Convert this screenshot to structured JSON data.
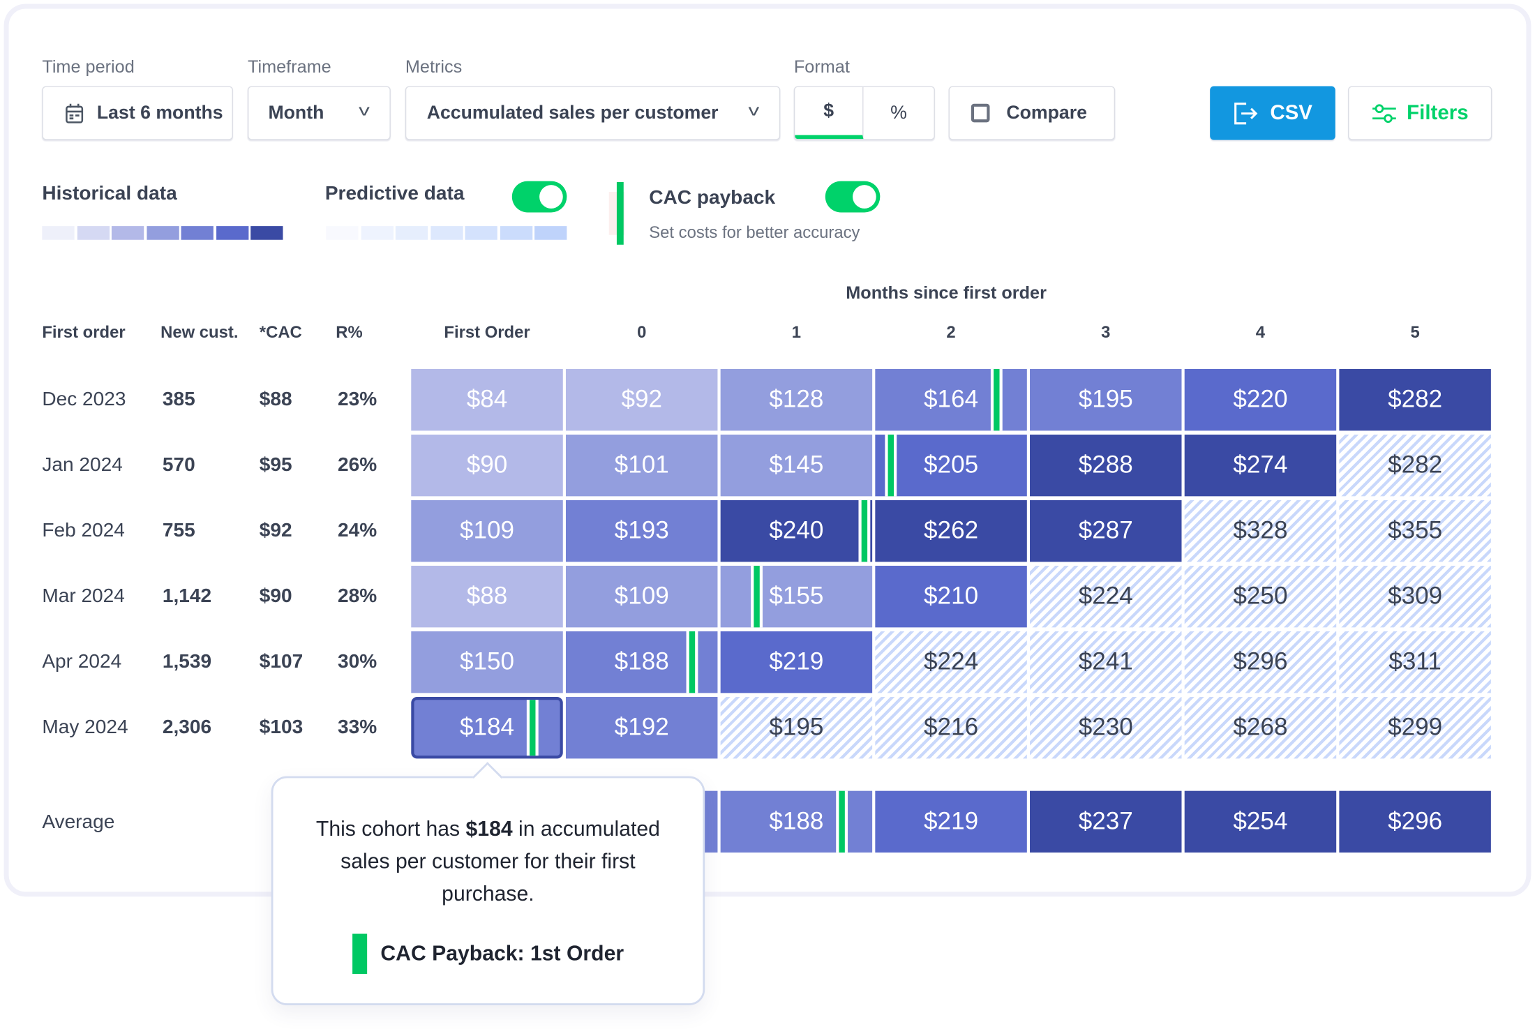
{
  "controls": {
    "time_period": {
      "label": "Time period",
      "value": "Last 6 months",
      "icon": "calendar-icon"
    },
    "timeframe": {
      "label": "Timeframe",
      "value": "Month"
    },
    "metrics": {
      "label": "Metrics",
      "value": "Accumulated sales per customer"
    },
    "format": {
      "label": "Format",
      "options": [
        "$",
        "%"
      ],
      "selected": "$"
    },
    "compare": {
      "label": "Compare",
      "checked": false
    },
    "csv": {
      "label": "CSV",
      "icon": "export-icon"
    },
    "filters": {
      "label": "Filters",
      "icon": "sliders-icon"
    }
  },
  "legend": {
    "historical": {
      "label": "Historical data",
      "swatches": [
        "#eef0fa",
        "#d5d9f3",
        "#b3b9e8",
        "#939ede",
        "#7280d4",
        "#5a6acc",
        "#3a4aa4"
      ]
    },
    "predictive": {
      "label": "Predictive data",
      "enabled": true,
      "swatches": [
        "#f8f9fe",
        "#eef3fe",
        "#e6eefd",
        "#dde8fd",
        "#d4e2fd",
        "#cbdcfc",
        "#bfd3fb"
      ]
    },
    "cac": {
      "label": "CAC payback",
      "sub": "Set costs for better accuracy",
      "enabled": true
    }
  },
  "colors": {
    "accent_green": "#00c863",
    "csv_blue": "#1297e0",
    "levels": [
      "#eef0fa",
      "#d5d9f3",
      "#b3b9e8",
      "#939ede",
      "#7280d4",
      "#5a6acc",
      "#3a4aa4"
    ]
  },
  "table": {
    "super_header": "Months since first order",
    "headers": [
      "First order",
      "New cust.",
      "*CAC",
      "R%"
    ],
    "month_headers": [
      "First Order",
      "0",
      "1",
      "2",
      "3",
      "4",
      "5"
    ],
    "rows": [
      {
        "first_order": "Dec 2023",
        "new_cust": "385",
        "cac": "$88",
        "r": "23%",
        "cells": [
          {
            "v": "$84",
            "l": 3
          },
          {
            "v": "$92",
            "l": 3
          },
          {
            "v": "$128",
            "l": 4
          },
          {
            "v": "$164",
            "l": 5,
            "payback": 0.8
          },
          {
            "v": "$195",
            "l": 5
          },
          {
            "v": "$220",
            "l": 6
          },
          {
            "v": "$282",
            "l": 7
          }
        ]
      },
      {
        "first_order": "Jan 2024",
        "new_cust": "570",
        "cac": "$95",
        "r": "26%",
        "cells": [
          {
            "v": "$90",
            "l": 3
          },
          {
            "v": "$101",
            "l": 4
          },
          {
            "v": "$145",
            "l": 4
          },
          {
            "v": "$205",
            "l": 6,
            "payback": 0.1
          },
          {
            "v": "$288",
            "l": 7
          },
          {
            "v": "$274",
            "l": 7
          },
          {
            "v": "$282",
            "p": true
          }
        ]
      },
      {
        "first_order": "Feb 2024",
        "new_cust": "755",
        "cac": "$92",
        "r": "24%",
        "cells": [
          {
            "v": "$109",
            "l": 4
          },
          {
            "v": "$193",
            "l": 5
          },
          {
            "v": "$240",
            "l": 7,
            "payback": 0.97
          },
          {
            "v": "$262",
            "l": 7
          },
          {
            "v": "$287",
            "l": 7
          },
          {
            "v": "$328",
            "p": true
          },
          {
            "v": "$355",
            "p": true
          }
        ]
      },
      {
        "first_order": "Mar 2024",
        "new_cust": "1,142",
        "cac": "$90",
        "r": "28%",
        "cells": [
          {
            "v": "$88",
            "l": 3
          },
          {
            "v": "$109",
            "l": 4
          },
          {
            "v": "$155",
            "l": 4,
            "payback": 0.24
          },
          {
            "v": "$210",
            "l": 6
          },
          {
            "v": "$224",
            "p": true
          },
          {
            "v": "$250",
            "p": true
          },
          {
            "v": "$309",
            "p": true
          }
        ]
      },
      {
        "first_order": "Apr 2024",
        "new_cust": "1,539",
        "cac": "$107",
        "r": "30%",
        "cells": [
          {
            "v": "$150",
            "l": 4
          },
          {
            "v": "$188",
            "l": 5,
            "payback": 0.83
          },
          {
            "v": "$219",
            "l": 6
          },
          {
            "v": "$224",
            "p": true
          },
          {
            "v": "$241",
            "p": true
          },
          {
            "v": "$296",
            "p": true
          },
          {
            "v": "$311",
            "p": true
          }
        ]
      },
      {
        "first_order": "May 2024",
        "new_cust": "2,306",
        "cac": "$103",
        "r": "33%",
        "cells": [
          {
            "v": "$184",
            "l": 5,
            "payback": 0.78,
            "selected": true
          },
          {
            "v": "$192",
            "l": 5
          },
          {
            "v": "$195",
            "p": true
          },
          {
            "v": "$216",
            "p": true
          },
          {
            "v": "$230",
            "p": true
          },
          {
            "v": "$268",
            "p": true
          },
          {
            "v": "$299",
            "p": true
          }
        ]
      }
    ],
    "average": {
      "label": "Average",
      "cells": [
        {
          "v": "",
          "l": 4
        },
        {
          "v": "",
          "l": 5
        },
        {
          "v": "$188",
          "l": 5,
          "payback": 0.8
        },
        {
          "v": "$219",
          "l": 6
        },
        {
          "v": "$237",
          "l": 7
        },
        {
          "v": "$254",
          "l": 7
        },
        {
          "v": "$296",
          "l": 7
        }
      ]
    }
  },
  "tooltip": {
    "pre": "This cohort has ",
    "value": "$184",
    "post": " in accumulated sales per customer for their first purchase.",
    "payback": "CAC Payback: 1st Order"
  }
}
